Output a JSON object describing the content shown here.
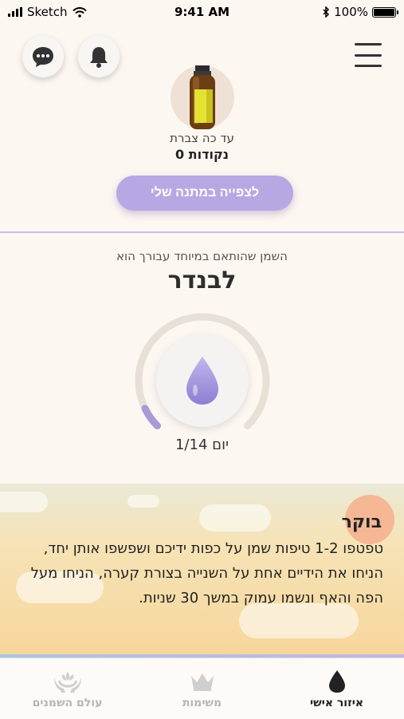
{
  "status_bar": {
    "carrier": "Sketch",
    "time": "9:41 AM",
    "battery": "100%"
  },
  "header": {
    "chat_icon": "chat-bubble-icon",
    "bell_icon": "bell-icon",
    "menu_icon": "hamburger-menu-icon"
  },
  "points": {
    "caption": "עד כה צברת",
    "value": "0 נקודות",
    "gift_button": "לצפייה במתנה שלי"
  },
  "oil": {
    "caption": "השמן שהותאם במיוחד עבורך הוא",
    "name": "לבנדר",
    "progress": 0.071
  },
  "day": {
    "label": "יום 1/14"
  },
  "routine": {
    "title": "בוקר",
    "text": "טפטפו 1-2 טיפות שמן על כפות ידיכם ושפשפו אותן יחד, הניחו את הידיים אחת על השנייה בצורת קערה, הניחו מעל הפה והאף ונשמו עמוק במשך 30 שניות."
  },
  "tabs": [
    {
      "label": "איזור אישי",
      "icon": "drop-icon",
      "active": true
    },
    {
      "label": "משימות",
      "icon": "crown-icon",
      "active": false
    },
    {
      "label": "עולם השמנים",
      "icon": "hands-lotus-icon",
      "active": false
    }
  ],
  "colors": {
    "accent": "#b7a8e3",
    "background": "#fdf7f2",
    "progress_arc": "#a99ad9"
  }
}
